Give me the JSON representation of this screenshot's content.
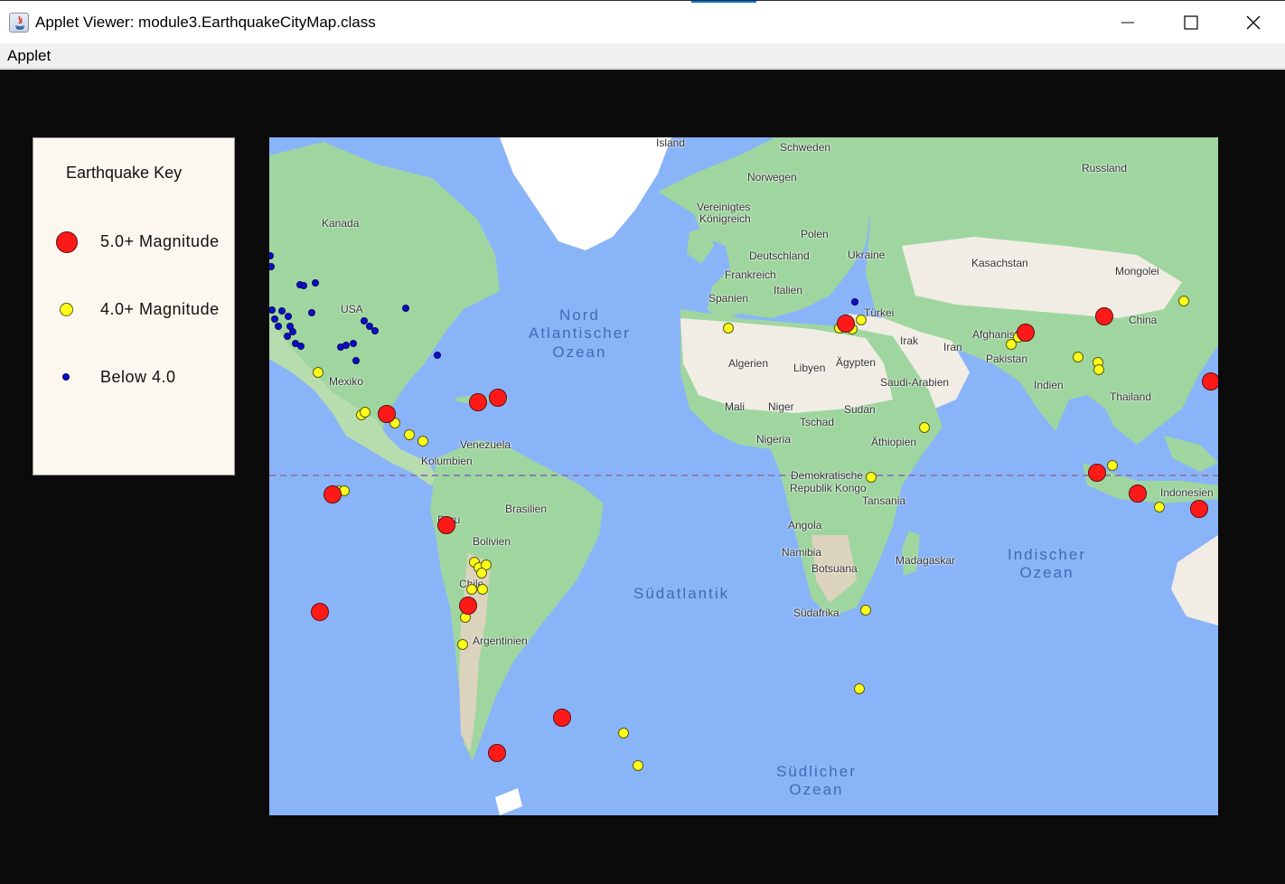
{
  "window": {
    "title": "Applet Viewer: module3.EarthquakeCityMap.class",
    "icon": "java-icon",
    "buttons": [
      "minimize-icon",
      "maximize-icon",
      "close-icon"
    ]
  },
  "menu": {
    "items": [
      "Applet"
    ]
  },
  "legend": {
    "title": "Earthquake Key",
    "entries": [
      {
        "label": "5.0+ Magnitude",
        "color": "#ff1a1a"
      },
      {
        "label": "4.0+ Magnitude",
        "color": "#ffff1a"
      },
      {
        "label": "Below 4.0",
        "color": "#0c0ccf"
      }
    ]
  },
  "map": {
    "labels": [
      "Island",
      "Schweden",
      "Russland",
      "Norwegen",
      "Vereinigtes",
      "Königreich",
      "Kanada",
      "Polen",
      "Deutschland",
      "Ukraine",
      "Kasachstan",
      "Frankreich",
      "Mongolei",
      "Italien",
      "Spanien",
      "USA",
      "Türkei",
      "China",
      "Irak",
      "Iran",
      "Afghanistan",
      "Pakistan",
      "Mexiko",
      "Algerien",
      "Libyen",
      "Ägypten",
      "Saudi-Arabien",
      "Indien",
      "Thailand",
      "Mali",
      "Niger",
      "Sudan",
      "Tschad",
      "Nigeria",
      "Äthiopien",
      "Venezuela",
      "Kolumbien",
      "Demokratische",
      "Republik Kongo",
      "Tansania",
      "Indonesien",
      "Brasilien",
      "Peru",
      "Bolivien",
      "Angola",
      "Namibia",
      "Botsuana",
      "Madagaskar",
      "Chile",
      "Südafrika",
      "Argentinien"
    ],
    "oceans": [
      {
        "line1": "Nord",
        "line2": "Atlantischer",
        "line3": "Ozean"
      },
      {
        "line1": "Indischer",
        "line2": "Ozean"
      },
      {
        "line1": "Südatlantik"
      },
      {
        "line1": "Südlicher",
        "line2": "Ozean"
      }
    ],
    "colors": {
      "ocean": "#8ab4f8",
      "land": "#9fd6a0",
      "desert": "#f1ede4",
      "ice": "#ffffff"
    }
  }
}
